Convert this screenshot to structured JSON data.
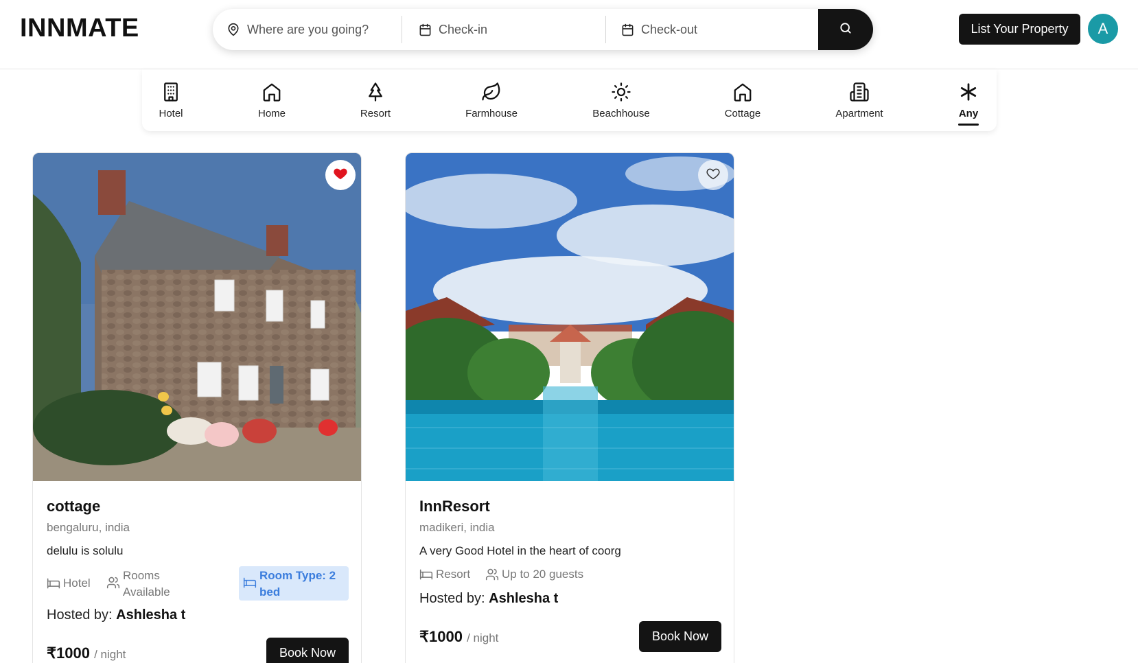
{
  "header": {
    "logo": "INNMATE",
    "search": {
      "where_placeholder": "Where are you going?",
      "checkin_placeholder": "Check-in",
      "checkout_placeholder": "Check-out",
      "search_icon": "search-icon",
      "location_icon": "map-pin-icon",
      "calendar_icon": "calendar-icon"
    },
    "list_property_label": "List Your Property",
    "avatar_initial": "A",
    "avatar_color": "#1a9aa6"
  },
  "categories": [
    {
      "label": "Hotel",
      "icon": "hotel-icon",
      "active": false
    },
    {
      "label": "Home",
      "icon": "home-icon",
      "active": false
    },
    {
      "label": "Resort",
      "icon": "tree-icon",
      "active": false
    },
    {
      "label": "Farmhouse",
      "icon": "leaf-icon",
      "active": false
    },
    {
      "label": "Beachhouse",
      "icon": "sun-icon",
      "active": false
    },
    {
      "label": "Cottage",
      "icon": "cottage-icon",
      "active": false
    },
    {
      "label": "Apartment",
      "icon": "apartment-icon",
      "active": false
    },
    {
      "label": "Any",
      "icon": "asterisk-icon",
      "active": true
    }
  ],
  "listings": [
    {
      "title": "cottage",
      "location": "bengaluru, india",
      "description": "delulu is solulu",
      "type": "Hotel",
      "rooms": "Rooms Available",
      "room_type": "Room Type: 2 bed",
      "hosted_prefix": "Hosted by:",
      "host": "Ashlesha t",
      "price": "₹1000",
      "per": "/ night",
      "book_label": "Book Now",
      "favorited": true,
      "image": "stone-cottage-photo"
    },
    {
      "title": "InnResort",
      "location": "madikeri, india",
      "description": "A very Good Hotel in the heart of coorg",
      "type": "Resort",
      "guests": "Up to 20 guests",
      "hosted_prefix": "Hosted by:",
      "host": "Ashlesha t",
      "price": "₹1000",
      "per": "/ night",
      "book_label": "Book Now",
      "favorited": false,
      "image": "resort-pool-photo"
    }
  ],
  "colors": {
    "primary_dark": "#141414",
    "favorite_red": "#e0141e",
    "room_type_bg": "#d9e8fb",
    "room_type_text": "#3b7ddd"
  }
}
